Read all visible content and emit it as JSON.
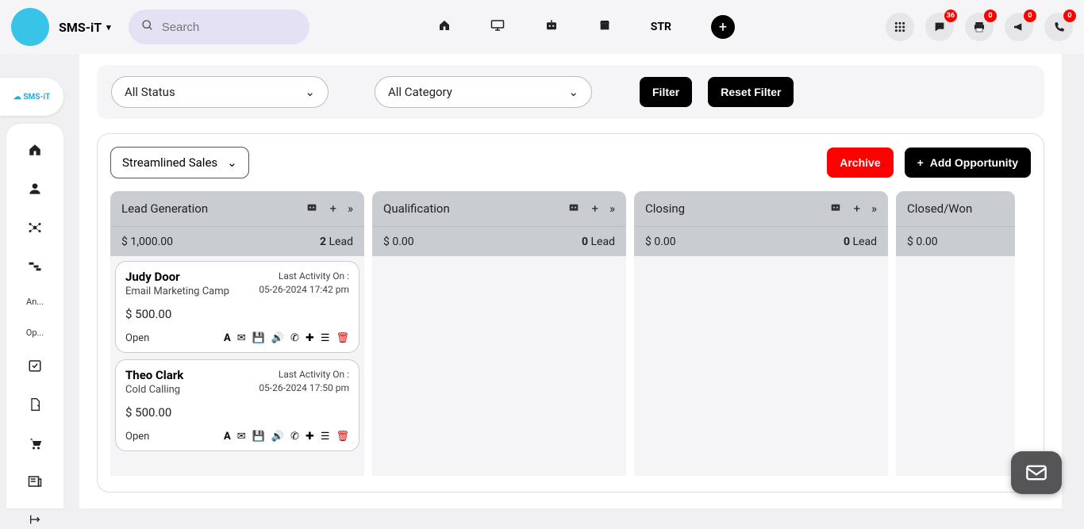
{
  "header": {
    "brand": "SMS-iT",
    "search_placeholder": "Search",
    "str_label": "STR",
    "badges": {
      "chat": "36",
      "print": "0",
      "megaphone": "0",
      "phone": "0"
    }
  },
  "logo_tab": "SMS-iT",
  "sidebar": {
    "items": [
      {
        "label": ""
      },
      {
        "label": ""
      },
      {
        "label": ""
      },
      {
        "label": ""
      },
      {
        "label": "An..."
      },
      {
        "label": "Op..."
      },
      {
        "label": ""
      },
      {
        "label": ""
      },
      {
        "label": ""
      },
      {
        "label": ""
      },
      {
        "label": ""
      }
    ]
  },
  "filters": {
    "status_label": "All Status",
    "category_label": "All Category",
    "filter_btn": "Filter",
    "reset_btn": "Reset Filter"
  },
  "board": {
    "pipeline": "Streamlined Sales",
    "archive_btn": "Archive",
    "add_btn": "Add Opportunity",
    "columns": [
      {
        "title": "Lead Generation",
        "amount": "$ 1,000.00",
        "count": "2",
        "count_unit": "Lead",
        "cards": [
          {
            "name": "Judy Door",
            "subtitle": "Email Marketing Camp",
            "last_label": "Last Activity On :",
            "last_value": "05-26-2024 17:42 pm",
            "amount": "$ 500.00",
            "status": "Open"
          },
          {
            "name": "Theo Clark",
            "subtitle": "Cold Calling",
            "last_label": "Last Activity On :",
            "last_value": "05-26-2024 17:50 pm",
            "amount": "$ 500.00",
            "status": "Open"
          }
        ]
      },
      {
        "title": "Qualification",
        "amount": "$ 0.00",
        "count": "0",
        "count_unit": "Lead",
        "cards": []
      },
      {
        "title": "Closing",
        "amount": "$ 0.00",
        "count": "0",
        "count_unit": "Lead",
        "cards": []
      },
      {
        "title": "Closed/Won",
        "amount": "$ 0.00",
        "count": "",
        "count_unit": "",
        "cards": []
      }
    ]
  }
}
